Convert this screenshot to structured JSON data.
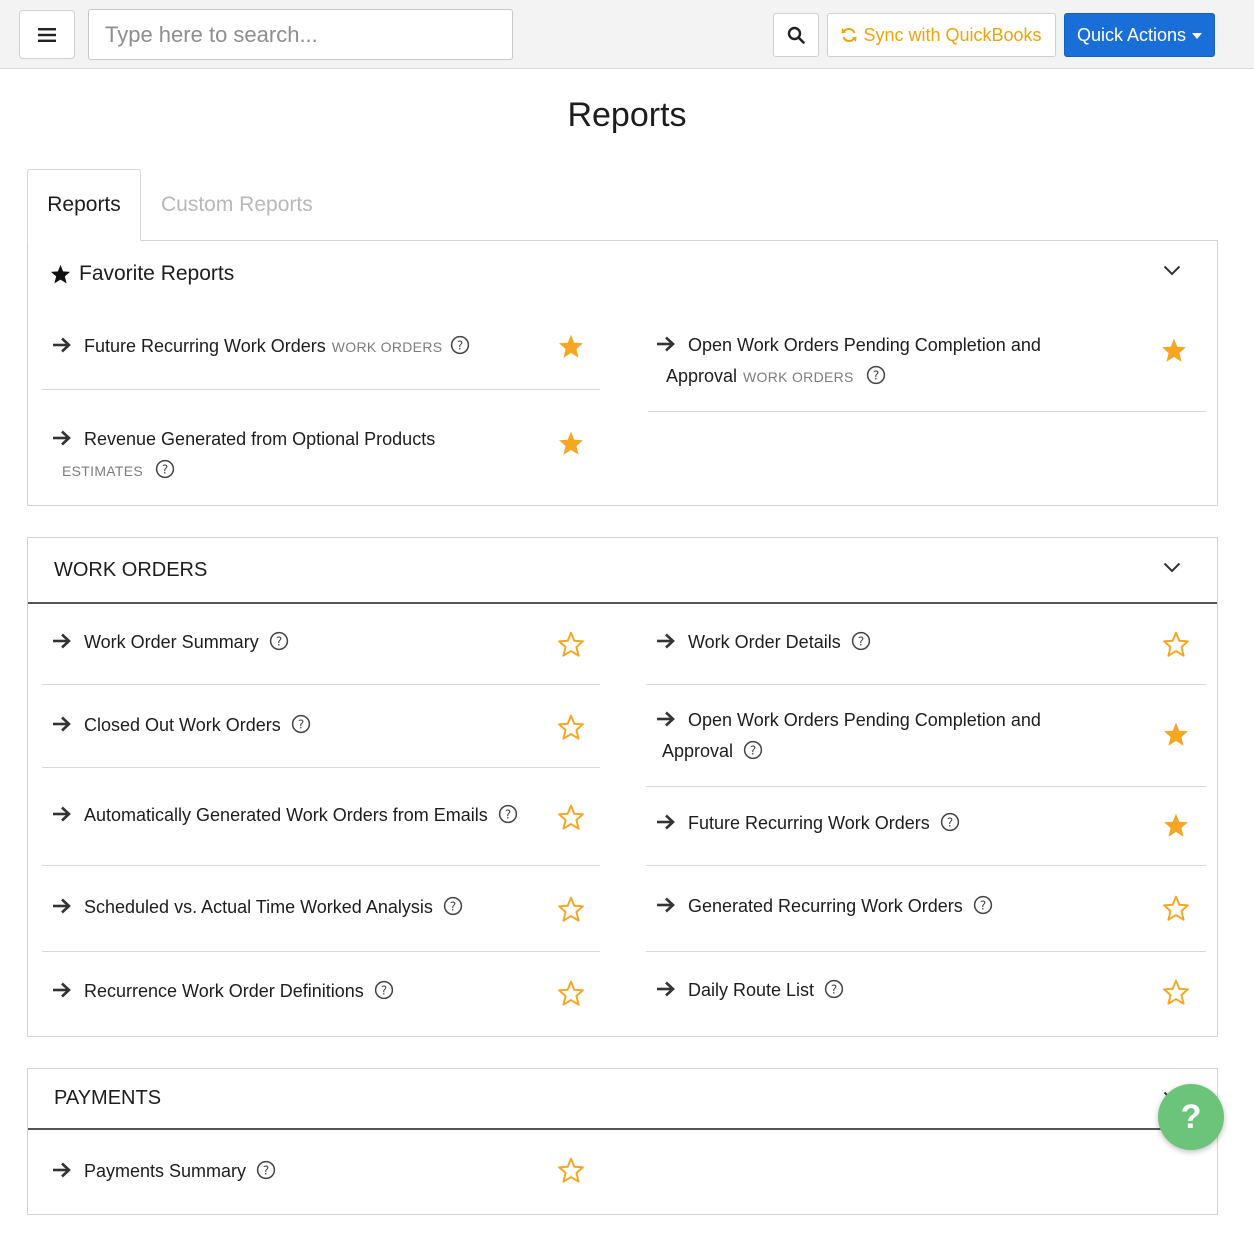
{
  "header": {
    "search_placeholder": "Type here to search...",
    "sync_label": "Sync with QuickBooks",
    "quick_actions_label": "Quick Actions"
  },
  "page": {
    "title": "Reports"
  },
  "tabs": [
    {
      "label": "Reports",
      "active": true
    },
    {
      "label": "Custom Reports",
      "active": false
    }
  ],
  "favorites": {
    "title": "Favorite Reports",
    "items": [
      {
        "label": "Future Recurring Work Orders",
        "tag": "WORK ORDERS",
        "favorite": true
      },
      {
        "label": "Open Work Orders Pending Completion and",
        "label2": "Approval",
        "tag": "WORK ORDERS",
        "favorite": true
      },
      {
        "label": "Revenue Generated from Optional Products",
        "tag": "ESTIMATES",
        "favorite": true
      }
    ]
  },
  "work_orders": {
    "title": "WORK ORDERS",
    "items": [
      {
        "label": "Work Order Summary",
        "favorite": false
      },
      {
        "label": "Work Order Details",
        "favorite": false
      },
      {
        "label": "Closed Out Work Orders",
        "favorite": false
      },
      {
        "label": "Open Work Orders Pending Completion and",
        "label2": "Approval",
        "favorite": true
      },
      {
        "label": "Automatically Generated Work Orders from Emails",
        "favorite": false
      },
      {
        "label": "Future Recurring Work Orders",
        "favorite": true
      },
      {
        "label": "Scheduled vs. Actual Time Worked Analysis",
        "favorite": false
      },
      {
        "label": "Generated Recurring Work Orders",
        "favorite": false
      },
      {
        "label": "Recurrence Work Order Definitions",
        "favorite": false
      },
      {
        "label": "Daily Route List",
        "favorite": false
      }
    ]
  },
  "payments": {
    "title": "PAYMENTS",
    "items": [
      {
        "label": "Payments Summary",
        "favorite": false
      }
    ]
  },
  "help_fab": {
    "label": "?"
  },
  "colors": {
    "accent": "#1a6ed8",
    "star": "#f5a623",
    "sync": "#f0a30a",
    "fab": "#6cc47b"
  },
  "icons": [
    "menu-icon",
    "search-icon",
    "sync-icon",
    "caret-down-icon",
    "star-icon",
    "chevron-down-icon",
    "arrow-right-icon",
    "help-circle-icon"
  ]
}
